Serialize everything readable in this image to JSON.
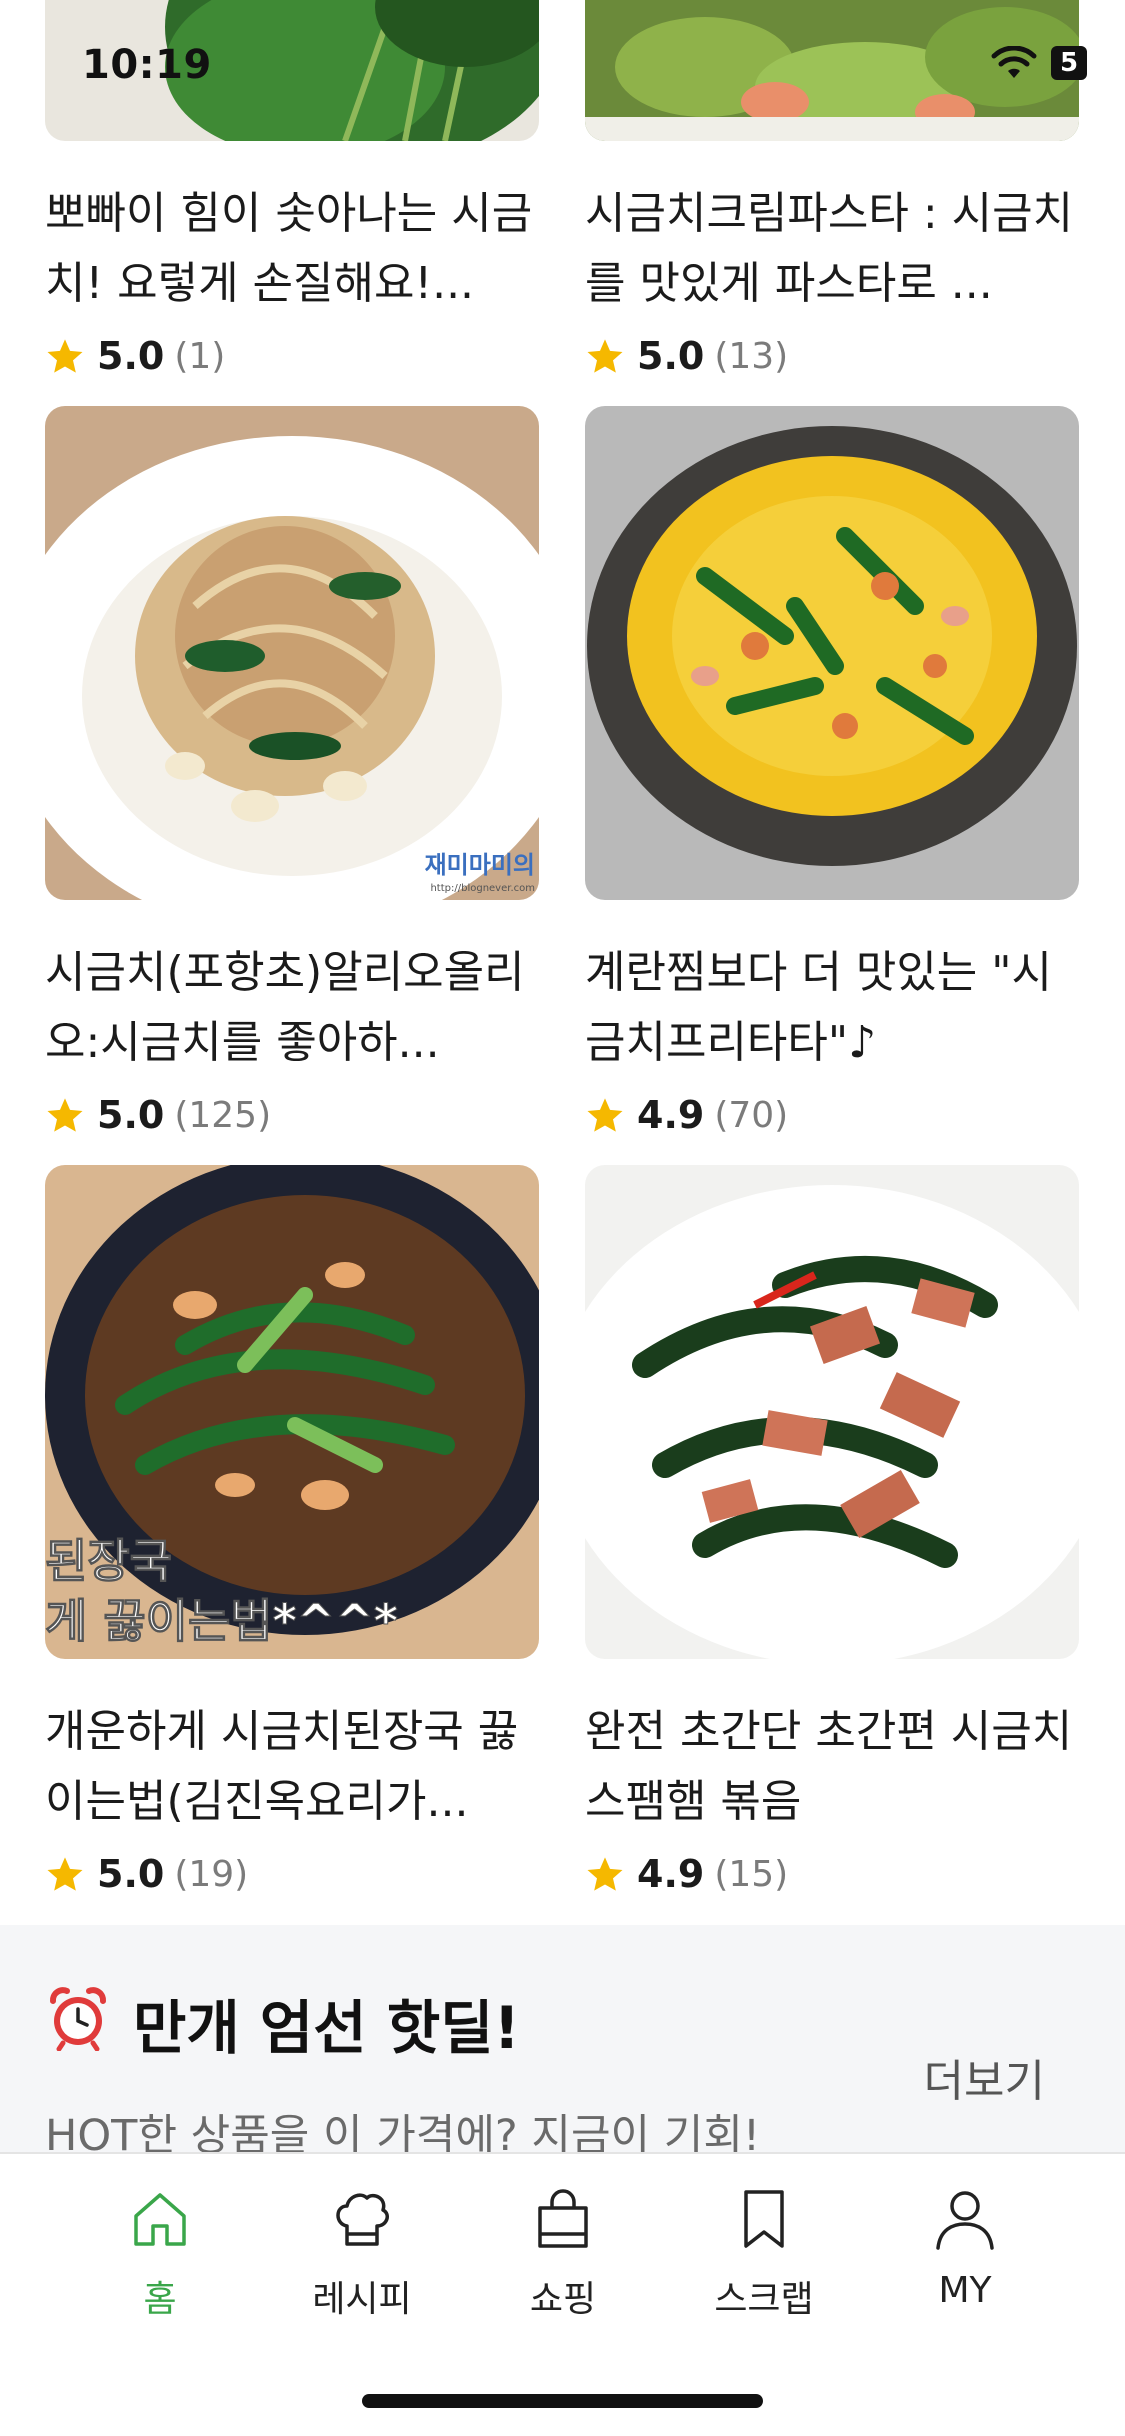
{
  "status_bar": {
    "time": "10:19",
    "battery": "5"
  },
  "recipes": [
    {
      "title": "뽀빠이 힘이 솟아나는 시금치! 요렇게 손질해요!...",
      "score": "5.0",
      "count": "(1)"
    },
    {
      "title": "시금치크림파스타 : 시금치를 맛있게 파스타로 ...",
      "score": "5.0",
      "count": "(13)"
    },
    {
      "title": "시금치(포항초)알리오올리오:시금치를 좋아하...",
      "score": "5.0",
      "count": "(125)"
    },
    {
      "title": "계란찜보다 더 맛있는 \"시금치프리타타\"♪",
      "score": "4.9",
      "count": "(70)"
    },
    {
      "title": "개운하게 시금치된장국 끓이는법(김진옥요리가...",
      "score": "5.0",
      "count": "(19)"
    },
    {
      "title": "완전 초간단 초간편 시금치 스팸햄 볶음",
      "score": "4.9",
      "count": "(15)"
    }
  ],
  "image_overlays": {
    "pasta_watermark": "재미마미의",
    "pasta_watermark_url": "http://blognever.com",
    "soup_caption_1": "된장국",
    "soup_caption_2": "게 끓이는법*^^*"
  },
  "hot_deal": {
    "title": "만개 엄선 핫딜!",
    "subtitle": "HOT한 상품을 이 가격에? 지금이 기회!",
    "more_label": "더보기"
  },
  "tab_bar": {
    "items": [
      {
        "label": "홈",
        "icon": "home-icon",
        "active": true
      },
      {
        "label": "레시피",
        "icon": "chef-hat-icon",
        "active": false
      },
      {
        "label": "쇼핑",
        "icon": "shopping-bag-icon",
        "active": false
      },
      {
        "label": "스크랩",
        "icon": "bookmark-icon",
        "active": false
      },
      {
        "label": "MY",
        "icon": "person-icon",
        "active": false
      }
    ]
  },
  "colors": {
    "accent_green": "#3aa64a",
    "star_yellow": "#f5b800",
    "hot_deal_bg": "#f5f6f8"
  }
}
